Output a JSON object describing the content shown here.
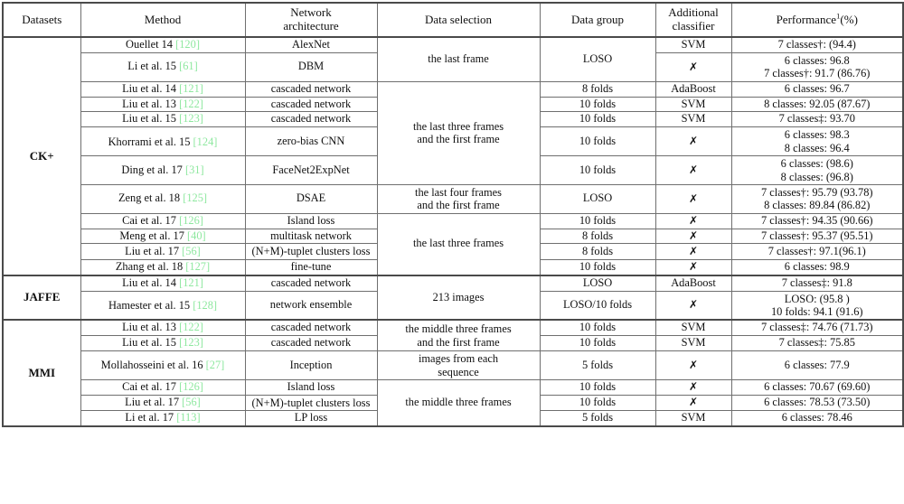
{
  "table": {
    "caption_symbols": {
      "dagger": "†",
      "double_dagger": "‡",
      "xmark": "✗"
    },
    "headers": [
      "Datasets",
      "Method",
      "Network architecture",
      "Data selection",
      "Data group",
      "Additional classifier",
      "Performance¹(%)"
    ],
    "header_parts": {
      "datasets": "Datasets",
      "method": "Method",
      "network_architecture_l1": "Network",
      "network_architecture_l2": "architecture",
      "data_selection": "Data selection",
      "data_group": "Data group",
      "additional_classifier_l1": "Additional",
      "additional_classifier_l2": "classifier",
      "performance_text": "Performance",
      "performance_sup": "1",
      "performance_unit": "(%)"
    },
    "groups": [
      {
        "dataset": "CK+",
        "rows": [
          {
            "method_text": "Ouellet 14 ",
            "method_cite": "[120]",
            "architecture": "AlexNet",
            "data_selection": "the last frame",
            "data_group": "LOSO",
            "classifier": "SVM",
            "performance": [
              "7 classes†: (94.4)"
            ]
          },
          {
            "method_text": "Li et al. 15 ",
            "method_cite": "[61]",
            "architecture": "DBM",
            "data_selection": "",
            "data_group": "",
            "classifier": "✗",
            "performance": [
              "6 classes: 96.8",
              "7 classes†: 91.7 (86.76)"
            ]
          },
          {
            "method_text": "Liu et al. 14 ",
            "method_cite": "[121]",
            "architecture": "cascaded network",
            "data_selection": "",
            "data_group": "8 folds",
            "classifier": "AdaBoost",
            "performance": [
              "6 classes: 96.7"
            ]
          },
          {
            "method_text": "Liu et al. 13 ",
            "method_cite": "[122]",
            "architecture": "cascaded network",
            "data_selection": "the last three frames and the first frame",
            "data_group": "10 folds",
            "classifier": "SVM",
            "performance": [
              "8 classes: 92.05 (87.67)"
            ]
          },
          {
            "method_text": "Liu et al. 15 ",
            "method_cite": "[123]",
            "architecture": "cascaded network",
            "data_selection": "",
            "data_group": "10 folds",
            "classifier": "SVM",
            "performance": [
              "7 classes‡: 93.70"
            ]
          },
          {
            "method_text": "Khorrami et al. 15 ",
            "method_cite": "[124]",
            "architecture": "zero-bias CNN",
            "data_selection": "",
            "data_group": "10 folds",
            "classifier": "✗",
            "performance": [
              "6 classes: 98.3",
              "8 classes: 96.4"
            ]
          },
          {
            "method_text": "Ding et al. 17 ",
            "method_cite": "[31]",
            "architecture": "FaceNet2ExpNet",
            "data_selection": "",
            "data_group": "10 folds",
            "classifier": "✗",
            "performance": [
              "6 classes: (98.6)",
              "8 classes: (96.8)"
            ]
          },
          {
            "method_text": "Zeng et al. 18 ",
            "method_cite": "[125]",
            "architecture": "DSAE",
            "data_selection": "the last four frames and the first frame",
            "data_group": "LOSO",
            "classifier": "✗",
            "performance": [
              "7 classes†: 95.79 (93.78)",
              "8 classes: 89.84 (86.82)"
            ]
          },
          {
            "method_text": "Cai et al. 17 ",
            "method_cite": "[126]",
            "architecture": "Island loss",
            "data_selection": "",
            "data_group": "10 folds",
            "classifier": "✗",
            "performance": [
              "7 classes†: 94.35 (90.66)"
            ]
          },
          {
            "method_text": "Meng et al. 17 ",
            "method_cite": "[40]",
            "architecture": "multitask network",
            "data_selection": "",
            "data_group": "8 folds",
            "classifier": "✗",
            "performance": [
              "7 classes†: 95.37 (95.51)"
            ]
          },
          {
            "method_text": "Liu et al. 17 ",
            "method_cite": "[56]",
            "architecture": "(N+M)-tuplet clusters loss",
            "data_selection": "the last three frames",
            "data_group": "8 folds",
            "classifier": "✗",
            "performance": [
              "7 classes†: 97.1(96.1)"
            ]
          },
          {
            "method_text": "Zhang et al. 18 ",
            "method_cite": "[127]",
            "architecture": "fine-tune",
            "data_selection": "",
            "data_group": "10 folds",
            "classifier": "✗",
            "performance": [
              "6 classes: 98.9"
            ]
          }
        ]
      },
      {
        "dataset": "JAFFE",
        "rows": [
          {
            "method_text": "Liu et al. 14 ",
            "method_cite": "[121]",
            "architecture": "cascaded network",
            "data_selection": "213 images",
            "data_group": "LOSO",
            "classifier": "AdaBoost",
            "performance": [
              "7 classes‡: 91.8"
            ]
          },
          {
            "method_text": "Hamester et al. 15 ",
            "method_cite": "[128]",
            "architecture": "network ensemble",
            "data_selection": "",
            "data_group": "LOSO/10 folds",
            "classifier": "✗",
            "performance": [
              "LOSO: (95.8 )",
              "10 folds: 94.1 (91.6)"
            ]
          }
        ]
      },
      {
        "dataset": "MMI",
        "rows": [
          {
            "method_text": "Liu et al. 13 ",
            "method_cite": "[122]",
            "architecture": "cascaded network",
            "data_selection": "the middle three frames and the first frame",
            "data_group": "10 folds",
            "classifier": "SVM",
            "performance": [
              "7 classes‡: 74.76 (71.73)"
            ]
          },
          {
            "method_text": "Liu et al. 15 ",
            "method_cite": "[123]",
            "architecture": "cascaded network",
            "data_selection": "",
            "data_group": "10 folds",
            "classifier": "SVM",
            "performance": [
              "7 classes‡: 75.85"
            ]
          },
          {
            "method_text": "Mollahosseini et al. 16 ",
            "method_cite": "[27]",
            "architecture": "Inception",
            "data_selection": "images from each sequence",
            "data_group": "5 folds",
            "classifier": "✗",
            "performance": [
              "6 classes: 77.9"
            ]
          },
          {
            "method_text": "Cai et al. 17 ",
            "method_cite": "[126]",
            "architecture": "Island loss",
            "data_selection": "",
            "data_group": "10 folds",
            "classifier": "✗",
            "performance": [
              "6 classes: 70.67 (69.60)"
            ]
          },
          {
            "method_text": "Liu et al. 17 ",
            "method_cite": "[56]",
            "architecture": "(N+M)-tuplet clusters loss",
            "data_selection": "the middle three frames",
            "data_group": "10 folds",
            "classifier": "✗",
            "performance": [
              "6 classes: 78.53 (73.50)"
            ]
          },
          {
            "method_text": "Li et al. 17 ",
            "method_cite": "[113]",
            "architecture": "LP loss",
            "data_selection": "",
            "data_group": "5 folds",
            "classifier": "SVM",
            "performance": [
              "6 classes: 78.46"
            ]
          }
        ]
      }
    ],
    "merged_selection_cells": {
      "ck_last_frame": {
        "text": "the last frame",
        "rowspan": 2
      },
      "ck_last_three_first": {
        "text_l1": "the last three frames",
        "text_l2": "and the first frame",
        "rowspan": 5
      },
      "ck_last_four_first": {
        "text_l1": "the last four frames",
        "text_l2": "and the first frame",
        "rowspan": 1
      },
      "ck_last_three": {
        "text": "the last three frames",
        "rowspan": 4
      },
      "jaffe_213": {
        "text": "213 images",
        "rowspan": 2
      },
      "mmi_mid_three_first": {
        "text_l1": "the middle three frames",
        "text_l2": "and the first frame",
        "rowspan": 2
      },
      "mmi_images_each_seq": {
        "text_l1": "images from each",
        "text_l2": "sequence",
        "rowspan": 1
      },
      "mmi_mid_three": {
        "text": "the middle three frames",
        "rowspan": 3
      }
    },
    "merged_group_cells": {
      "ck_loso_1": {
        "text": "LOSO",
        "rowspan": 2
      },
      "ck_loso_2": {
        "text": "LOSO",
        "rowspan": 1
      }
    },
    "colors": {
      "citation_green": "#8fe8a0",
      "border_light": "#6f6f6f",
      "border_heavy": "#4a4a4a",
      "text": "#101010",
      "background": "#ffffff"
    }
  }
}
